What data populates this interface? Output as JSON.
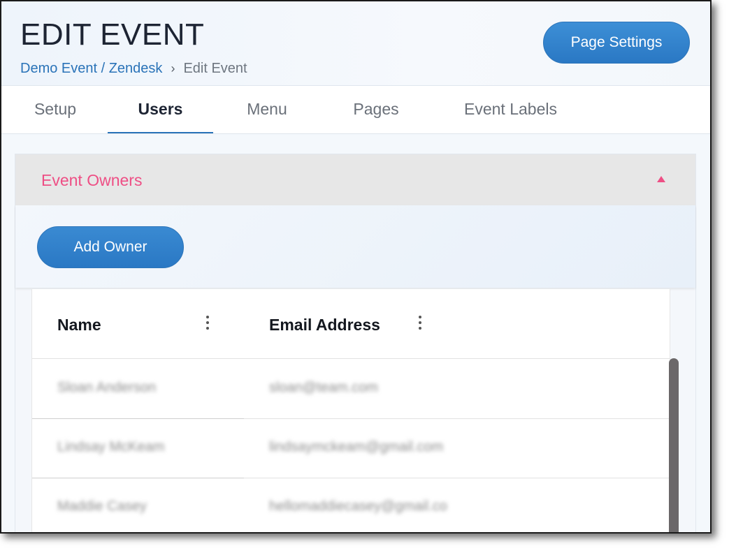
{
  "header": {
    "title": "EDIT EVENT",
    "breadcrumb": {
      "link": "Demo Event / Zendesk",
      "separator": "›",
      "current": "Edit Event"
    },
    "page_settings_label": "Page Settings"
  },
  "tabs": [
    {
      "label": "Setup",
      "active": false
    },
    {
      "label": "Users",
      "active": true
    },
    {
      "label": "Menu",
      "active": false
    },
    {
      "label": "Pages",
      "active": false
    },
    {
      "label": "Event Labels",
      "active": false
    }
  ],
  "owners_panel": {
    "title": "Event Owners",
    "expanded": true,
    "add_button_label": "Add Owner",
    "table": {
      "columns": [
        "Name",
        "Email Address"
      ],
      "rows": [
        {
          "name": "Sloan Anderson",
          "email": "sloan@team.com"
        },
        {
          "name": "Lindsay McKeam",
          "email": "lindsaymckeam@gmail.com"
        },
        {
          "name": "Maddie Casey",
          "email": "hellomaddiecasey@gmail.co"
        }
      ]
    }
  },
  "colors": {
    "accent": "#2a73b8",
    "panel_title": "#ee4f85",
    "button": "#2a78c4"
  },
  "icons": {
    "breadcrumb_separator": "chevron-right-icon",
    "collapse": "caret-up-icon",
    "column_menu": "kebab-menu-icon"
  }
}
